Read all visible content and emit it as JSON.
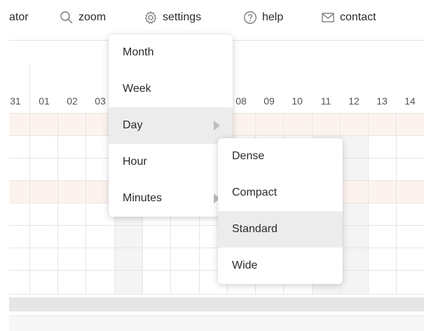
{
  "toolbar": {
    "truncated_label": "ator",
    "zoom_label": "zoom",
    "settings_label": "settings",
    "help_label": "help",
    "contact_label": "contact",
    "icons": [
      "search-icon",
      "gear-icon",
      "help-circle-icon",
      "mail-icon"
    ]
  },
  "timeline": {
    "day_labels": [
      "31",
      "01",
      "02",
      "03",
      "08",
      "09",
      "10",
      "11",
      "12",
      "13",
      "14"
    ]
  },
  "zoom_menu": {
    "items": [
      {
        "label": "Month"
      },
      {
        "label": "Week"
      },
      {
        "label": "Day",
        "selected": true,
        "has_submenu": true
      },
      {
        "label": "Hour"
      },
      {
        "label": "Minutes",
        "has_submenu": true
      }
    ]
  },
  "density_submenu": {
    "items": [
      {
        "label": "Dense"
      },
      {
        "label": "Compact"
      },
      {
        "label": "Standard",
        "selected": true
      },
      {
        "label": "Wide"
      }
    ]
  },
  "colors": {
    "menu_highlight": "#ececec",
    "weekend_row": "#fdf3ee",
    "grid_line": "#e6e6e6"
  }
}
